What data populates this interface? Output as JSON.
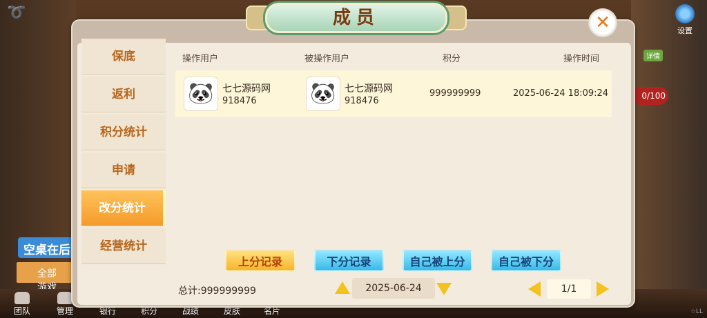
{
  "dialog": {
    "title": "成员"
  },
  "menu": [
    {
      "label": "保底"
    },
    {
      "label": "返利"
    },
    {
      "label": "积分统计"
    },
    {
      "label": "申请"
    },
    {
      "label": "改分统计",
      "active": true
    },
    {
      "label": "经营统计"
    }
  ],
  "table": {
    "headers": [
      "操作用户",
      "被操作用户",
      "积分",
      "操作时间"
    ],
    "rows": [
      {
        "operator_name": "七七源码网",
        "operator_id": "918476",
        "target_name": "七七源码网",
        "target_id": "918476",
        "points": "999999999",
        "time": "2025-06-24 18:09:24"
      }
    ]
  },
  "actions": {
    "up_record": "上分记录",
    "down_record": "下分记录",
    "self_up": "自己被上分",
    "self_down": "自己被下分"
  },
  "footer": {
    "total": "总计:999999999",
    "date": "2025-06-24",
    "page": "1/1"
  },
  "background": {
    "settings_label": "设置",
    "detail_badge": "详情",
    "side_badge": "0/100",
    "empty_table": "空桌在后",
    "all_games": "全部游戏",
    "bottom_nav": [
      "团队",
      "管理",
      "银行",
      "积分",
      "战绩",
      "皮肤",
      "名片"
    ]
  },
  "colors": {
    "accent_orange": "#f59a2a",
    "accent_blue": "#38b8e8",
    "title_green": "#a9d4b6"
  }
}
